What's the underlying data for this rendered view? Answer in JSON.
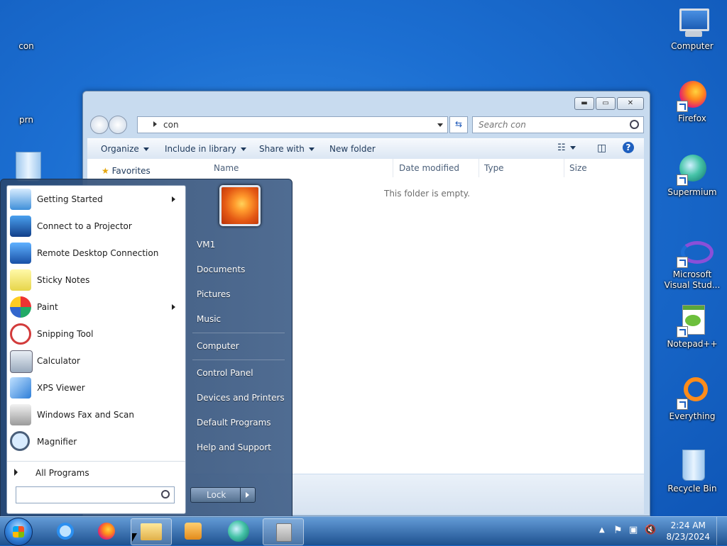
{
  "desktop": {
    "left_icons": [
      {
        "label": "con"
      },
      {
        "label": "prn"
      }
    ],
    "right_icons": [
      {
        "label": "Computer",
        "icon": "computer-icon"
      },
      {
        "label": "Firefox",
        "icon": "firefox-icon"
      },
      {
        "label": "Supermium",
        "icon": "supermium-icon"
      },
      {
        "label": "Microsoft Visual Stud...",
        "icon": "visual-studio-icon"
      },
      {
        "label": "Notepad++",
        "icon": "notepad-plus-plus-icon"
      },
      {
        "label": "Everything",
        "icon": "everything-icon"
      },
      {
        "label": "Recycle Bin",
        "icon": "recycle-bin-icon"
      }
    ]
  },
  "explorer": {
    "address": "con",
    "search_placeholder": "Search con",
    "toolbar": {
      "organize": "Organize",
      "include_in_library": "Include in library",
      "share_with": "Share with",
      "new_folder": "New folder"
    },
    "nav": {
      "favorites": "Favorites"
    },
    "columns": [
      "Name",
      "Date modified",
      "Type",
      "Size"
    ],
    "empty_message": "This folder is empty."
  },
  "start_menu": {
    "programs": [
      {
        "label": "Getting Started",
        "submenu": true
      },
      {
        "label": "Connect to a Projector",
        "submenu": false
      },
      {
        "label": "Remote Desktop Connection",
        "submenu": false
      },
      {
        "label": "Sticky Notes",
        "submenu": false
      },
      {
        "label": "Paint",
        "submenu": true
      },
      {
        "label": "Snipping Tool",
        "submenu": false
      },
      {
        "label": "Calculator",
        "submenu": false
      },
      {
        "label": "XPS Viewer",
        "submenu": false
      },
      {
        "label": "Windows Fax and Scan",
        "submenu": false
      },
      {
        "label": "Magnifier",
        "submenu": false
      }
    ],
    "all_programs": "All Programs",
    "right_links": {
      "user": "VM1",
      "documents": "Documents",
      "pictures": "Pictures",
      "music": "Music",
      "computer": "Computer",
      "control_panel": "Control Panel",
      "devices_printers": "Devices and Printers",
      "default_programs": "Default Programs",
      "help_support": "Help and Support"
    },
    "lock_label": "Lock"
  },
  "taskbar": {
    "clock_time": "2:24 AM",
    "clock_date": "8/23/2024"
  }
}
